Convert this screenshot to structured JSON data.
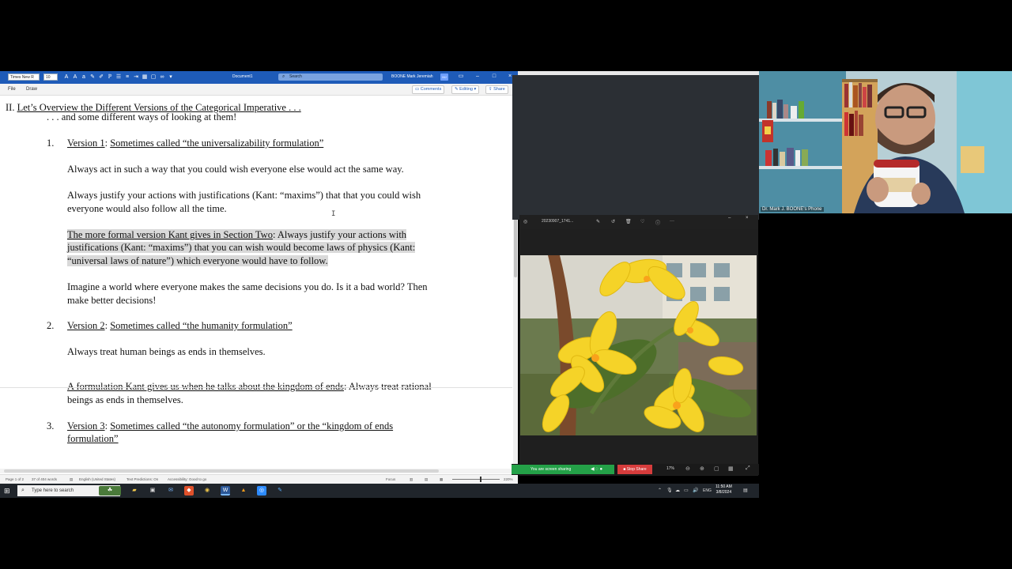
{
  "word": {
    "font_name": "Times New R",
    "font_size": "10",
    "document_name": "Document1",
    "search_placeholder": "Search",
    "user_name": "BOONE Mark Jeremiah",
    "user_initials": "MJ",
    "menu": {
      "file": "File",
      "draw": "Draw"
    },
    "ribbon": {
      "comments": "Comments",
      "editing": "Editing",
      "share": "Share"
    },
    "doc": {
      "heading_num": "II. ",
      "heading": "Let’s Overview the Different Versions of the Categorical Imperative . . .",
      "sub": ". . . and some different ways of looking at them!",
      "v1_num": "1.",
      "v1_label": "Version 1",
      "v1_sep": ": ",
      "v1_title": "Sometimes called “the universalizability formulation”",
      "v1_p1": "Always act in such a way that you could wish everyone else would act the same way.",
      "v1_p2_l1": "Always justify your actions with justifications (Kant: “maxims”) that that you could wish",
      "v1_p2_l2": "everyone would also follow all the time.",
      "v1_p3_u": "The more formal version Kant gives in Section Two",
      "v1_p3_l1": ": Always justify your actions with",
      "v1_p3_l2": "justifications (Kant: “maxims”) that you can wish would become laws of physics (Kant:",
      "v1_p3_l3": "“universal laws of nature”) which everyone would have to follow.",
      "v1_p4_l1": "Imagine a world where everyone makes the same decisions you do.  Is it a bad world?  Then",
      "v1_p4_l2": "make better decisions!",
      "v2_num": "2.",
      "v2_label": "Version 2",
      "v2_sep": ": ",
      "v2_title": "Sometimes called “the humanity formulation”",
      "v2_p1": "Always treat human beings as ends in themselves.",
      "v2_p2_u": "A formulation Kant gives us when he talks about the kingdom of ends",
      "v2_p2_l1": ": Always treat rational",
      "v2_p2_l2": "beings as ends in themselves.",
      "v3_num": "3.",
      "v3_label": "Version 3",
      "v3_sep": ": ",
      "v3_title_l1": "Sometimes called “the autonomy formulation” or the “kingdom of ends",
      "v3_title_l2": "formulation”"
    },
    "status": {
      "page": "Page 1 of 2",
      "words": "37 of 404 words",
      "language": "English (United States)",
      "predictions": "Text Predictions: On",
      "accessibility": "Accessibility: Good to go",
      "focus": "Focus",
      "zoom": "220%"
    }
  },
  "webcam": {
    "name": "Dr. Mark J. BOONE's Phone"
  },
  "photos": {
    "filename": "20230907_1741..."
  },
  "zoom_share": {
    "sharing": "You are screen sharing",
    "stop": "Stop Share",
    "percent": "17%"
  },
  "taskbar": {
    "search_placeholder": "Type here to search",
    "language": "ENG",
    "time": "11:50 AM",
    "date": "3/8/2024"
  },
  "colors": {
    "word_blue": "#1e5bb8",
    "zoom_green": "#24a148",
    "zoom_red": "#d63c3c",
    "highlight": "#d9d9d9"
  }
}
